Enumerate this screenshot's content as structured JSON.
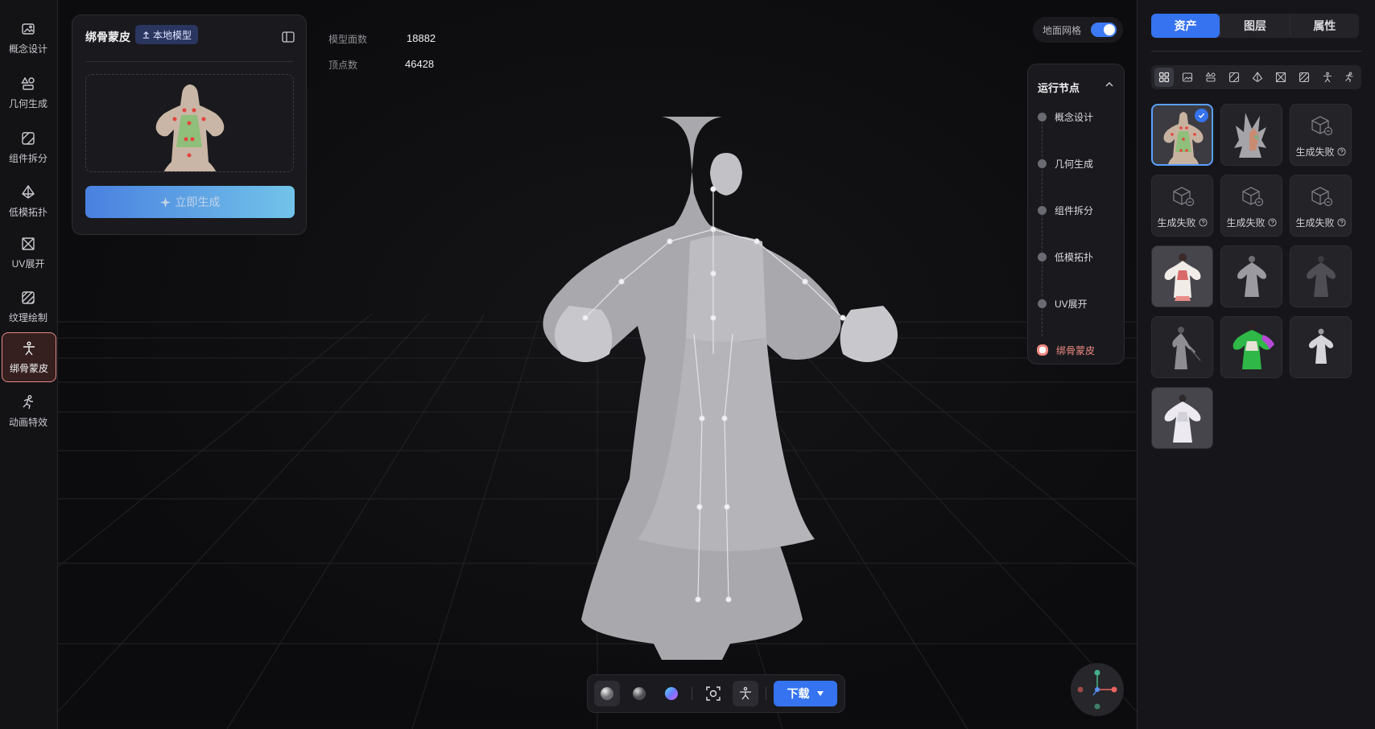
{
  "sidebar": {
    "items": [
      {
        "label": "概念设计",
        "icon": "image-icon"
      },
      {
        "label": "几何生成",
        "icon": "shapes-icon"
      },
      {
        "label": "组件拆分",
        "icon": "split-icon"
      },
      {
        "label": "低模拓扑",
        "icon": "pyramid-icon"
      },
      {
        "label": "UV展开",
        "icon": "uv-icon"
      },
      {
        "label": "纹理绘制",
        "icon": "texture-icon"
      },
      {
        "label": "绑骨蒙皮",
        "icon": "rig-figure-icon",
        "active": true
      },
      {
        "label": "动画特效",
        "icon": "running-figure-icon"
      }
    ]
  },
  "gen_panel": {
    "title": "绑骨蒙皮",
    "badge": "本地模型",
    "button": "立即生成"
  },
  "stats": {
    "faces_label": "模型面数",
    "faces_value": "18882",
    "vertices_label": "顶点数",
    "vertices_value": "46428"
  },
  "grid_toggle": {
    "label": "地面网格",
    "on": true
  },
  "run_nodes": {
    "title": "运行节点",
    "items": [
      {
        "label": "概念设计",
        "state": "done"
      },
      {
        "label": "几何生成",
        "state": "done"
      },
      {
        "label": "组件拆分",
        "state": "done"
      },
      {
        "label": "低模拓扑",
        "state": "done"
      },
      {
        "label": "UV展开",
        "state": "done"
      },
      {
        "label": "绑骨蒙皮",
        "state": "current"
      }
    ]
  },
  "toolbar": {
    "buttons": [
      "clay-sphere-icon",
      "matte-sphere-icon",
      "normal-sphere-icon",
      "frame-focus-icon",
      "skeleton-icon"
    ],
    "download": "下载"
  },
  "right_panel": {
    "tabs": [
      "资产",
      "图层",
      "属性"
    ],
    "active_tab": "资产",
    "filters": [
      "all-grid-icon",
      "image-icon",
      "shapes-icon",
      "split-icon",
      "pyramid-icon",
      "uv-icon",
      "texture-icon",
      "rig-figure-icon",
      "running-figure-icon"
    ],
    "assets": [
      {
        "kind": "rigged-figure",
        "selected": true
      },
      {
        "kind": "parts-figure"
      },
      {
        "kind": "failed",
        "label": "生成失败"
      },
      {
        "kind": "failed",
        "label": "生成失败"
      },
      {
        "kind": "failed",
        "label": "生成失败"
      },
      {
        "kind": "failed",
        "label": "生成失败"
      },
      {
        "kind": "textured-figure-light"
      },
      {
        "kind": "grey-figure"
      },
      {
        "kind": "dark-figure"
      },
      {
        "kind": "grey-figure-sword"
      },
      {
        "kind": "green-figure"
      },
      {
        "kind": "white-figure"
      },
      {
        "kind": "white-figure-large"
      }
    ]
  },
  "colors": {
    "accent": "#3573f0",
    "active_node": "#f08a82",
    "background": "#0d0d0f",
    "panel": "#1a1a1e"
  }
}
